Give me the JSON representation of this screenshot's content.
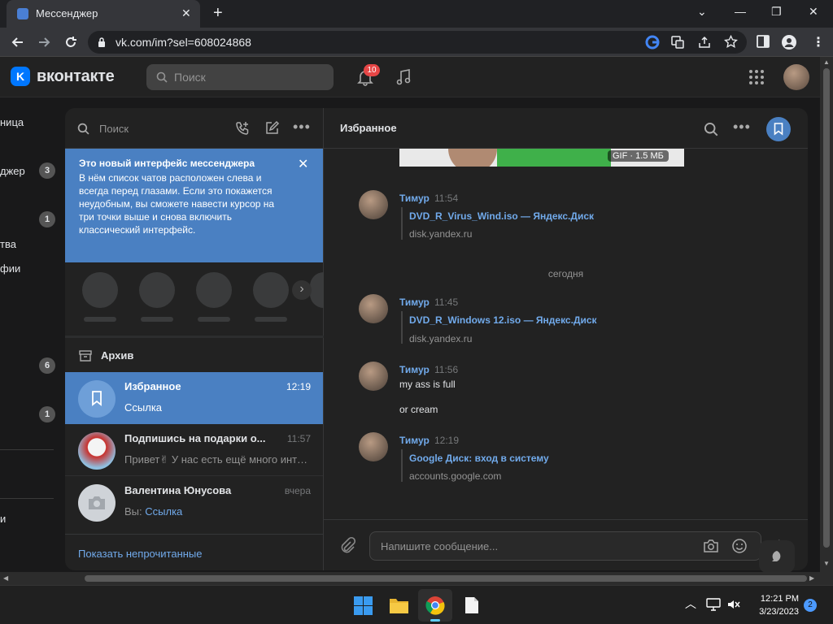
{
  "browser": {
    "tab_title": "Мессенджер",
    "url": "vk.com/im?sel=608024868"
  },
  "vk": {
    "brand": "вконтакте",
    "search_placeholder": "Поиск",
    "notifications_count": "10"
  },
  "left_nav": {
    "items": [
      "ница",
      "джер",
      "тва",
      "фии",
      "и"
    ],
    "badges": [
      "3",
      "1",
      "6",
      "1"
    ]
  },
  "chatlist": {
    "search_label": "Поиск",
    "notice_title": "Это новый интерфейс мессенджера",
    "notice_body": "В нём список чатов расположен слева и всегда перед глазами. Если это покажется неудобным, вы сможете навести курсор на три точки выше и снова включить классический интерфейс.",
    "archive_label": "Архив",
    "chats": [
      {
        "name": "Избранное",
        "time": "12:19",
        "preview": "Ссылка"
      },
      {
        "name": "Подпишись на подарки о...",
        "time": "11:57",
        "preview": "Привет✌ У нас есть ещё много инте..."
      },
      {
        "name": "Валентина Юнусова",
        "time": "вчера",
        "preview_prefix": "Вы:",
        "preview_link": "Ссылка"
      }
    ],
    "show_unread": "Показать непрочитанные"
  },
  "conversation": {
    "title": "Избранное",
    "gif_label": "GIF · 1.5 МБ",
    "date_separator": "сегодня",
    "messages": [
      {
        "author": "Тимур",
        "time": "11:54",
        "link_title": "DVD_R_Virus_Wind.iso — Яндекс.Диск",
        "domain": "disk.yandex.ru"
      },
      {
        "author": "Тимур",
        "time": "11:45",
        "link_title": "DVD_R_Windows 12.iso — Яндекс.Диск",
        "domain": "disk.yandex.ru"
      },
      {
        "author": "Тимур",
        "time": "11:56",
        "text1": "my ass is full",
        "text2": "or cream"
      },
      {
        "author": "Тимур",
        "time": "12:19",
        "link_title": "Google Диск: вход в систему",
        "domain": "accounts.google.com"
      }
    ],
    "input_placeholder": "Напишите сообщение..."
  },
  "taskbar": {
    "time": "12:21 PM",
    "date": "3/23/2023",
    "notification_count": "2"
  },
  "colors": {
    "accent": "#71aaeb",
    "selected": "#4a80c2",
    "badge_red": "#e64646"
  }
}
